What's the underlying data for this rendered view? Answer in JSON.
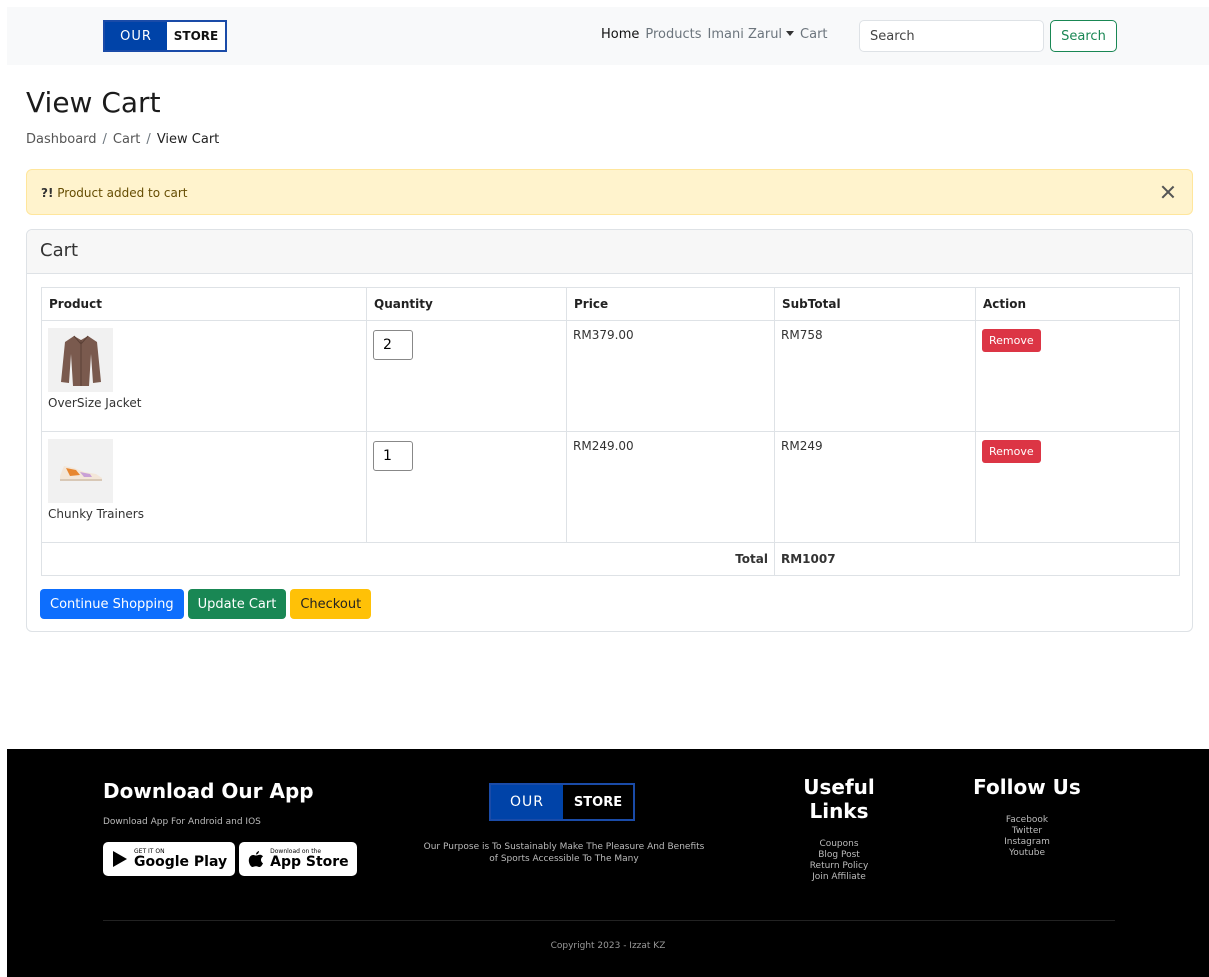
{
  "brand": {
    "part1": "OUR",
    "part2": "STORE",
    "accent": "#0043a8"
  },
  "navbar": {
    "links": [
      {
        "label": "Home"
      },
      {
        "label": "Products"
      },
      {
        "label": "Imani Zarul"
      },
      {
        "label": "Cart"
      }
    ],
    "search_placeholder": "Search",
    "search_button": "Search"
  },
  "page": {
    "title": "View Cart",
    "breadcrumb": [
      "Dashboard",
      "Cart",
      "View Cart"
    ]
  },
  "alert": {
    "icon_text": "?!",
    "message": "Product added to cart"
  },
  "cart": {
    "header": "Cart",
    "columns": [
      "Product",
      "Quantity",
      "Price",
      "SubTotal",
      "Action"
    ],
    "items": [
      {
        "name": "OverSize Jacket",
        "quantity": "2",
        "price": "RM379.00",
        "subtotal": "RM758",
        "action": "Remove"
      },
      {
        "name": "Chunky Trainers",
        "quantity": "1",
        "price": "RM249.00",
        "subtotal": "RM249",
        "action": "Remove"
      }
    ],
    "total_label": "Total",
    "total_value": "RM1007",
    "buttons": {
      "continue": "Continue Shopping",
      "update": "Update Cart",
      "checkout": "Checkout"
    }
  },
  "footer": {
    "app_title": "Download Our App",
    "app_sub": "Download App For Android and IOS",
    "google_small": "GET IT ON",
    "google_big": "Google Play",
    "apple_small": "Download on the",
    "apple_big": "App Store",
    "purpose": "Our Purpose is To Sustainably Make The Pleasure And Benefits of Sports Accessible To The Many",
    "links_title": "Useful Links",
    "links": [
      "Coupons",
      "Blog Post",
      "Return Policy",
      "Join Affiliate"
    ],
    "follow_title": "Follow Us",
    "follow": [
      "Facebook",
      "Twitter",
      "Instagram",
      "Youtube"
    ],
    "copyright": "Copyright 2023 - Izzat KZ"
  }
}
